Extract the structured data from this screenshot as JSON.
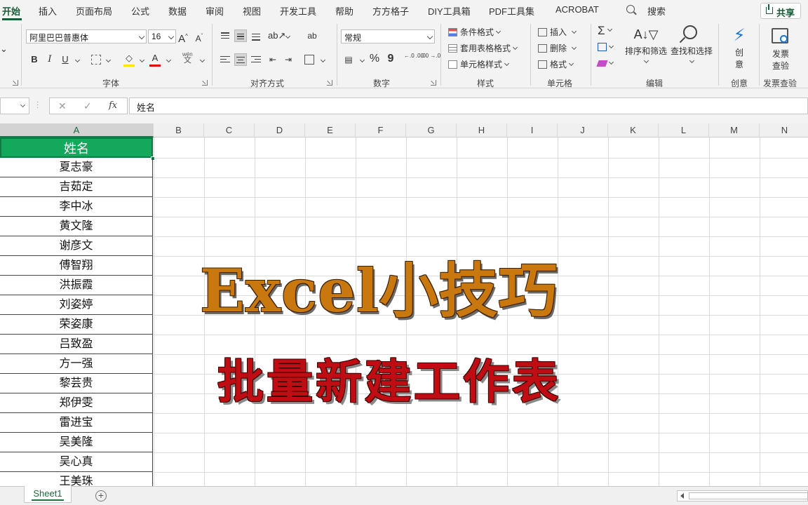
{
  "tabs": [
    "开始",
    "插入",
    "页面布局",
    "公式",
    "数据",
    "审阅",
    "视图",
    "开发工具",
    "帮助",
    "方方格子",
    "DIY工具箱",
    "PDF工具集",
    "ACROBAT"
  ],
  "search": {
    "label": "搜索"
  },
  "share": {
    "label": "共享"
  },
  "font": {
    "name": "阿里巴巴普惠体",
    "size": "16",
    "grow": "A",
    "shrink": "A",
    "bold": "B",
    "italic": "I",
    "underline": "U",
    "color_letter": "A",
    "phonetic_top": "wén",
    "phonetic_bottom": "文"
  },
  "align": {
    "wrap": "ab"
  },
  "number": {
    "format": "常规",
    "percent": "%",
    "comma": "9",
    "inc": "←.0 .00",
    "dec": ".00 →.0"
  },
  "styles": {
    "conditional": "条件格式",
    "table": "套用表格格式",
    "cell": "单元格样式"
  },
  "cells": {
    "insert": "插入",
    "delete": "删除",
    "format": "格式"
  },
  "editing": {
    "sigma": "Σ",
    "sort_filter": "排序和筛选",
    "find_select": "查找和选择"
  },
  "creative": {
    "label_line1": "创",
    "label_line2": "意"
  },
  "invoice": {
    "label_line1": "发票",
    "label_line2": "查验"
  },
  "group_labels": {
    "font": "字体",
    "alignment": "对齐方式",
    "number": "数字",
    "styles": "样式",
    "cells": "单元格",
    "editing": "编辑",
    "creative": "创意",
    "invoice": "发票查验"
  },
  "formula_bar": {
    "cancel": "✕",
    "enter": "✓",
    "fx": "fx",
    "content": "姓名"
  },
  "columns": [
    "A",
    "B",
    "C",
    "D",
    "E",
    "F",
    "G",
    "H",
    "I",
    "J",
    "K",
    "L",
    "M",
    "N"
  ],
  "header_cell": "姓名",
  "names": [
    "夏志豪",
    "吉茹定",
    "李中冰",
    "黄文隆",
    "谢彦文",
    "傅智翔",
    "洪振霞",
    "刘姿婷",
    "荣姿康",
    "吕致盈",
    "方一强",
    "黎芸贵",
    "郑伊雯",
    "雷进宝",
    "吴美隆",
    "吴心真",
    "王美珠"
  ],
  "overlay": {
    "title": "Excel小技巧",
    "subtitle": "批量新建工作表"
  },
  "sheet_tab": "Sheet1",
  "add_sheet": "+",
  "colors": {
    "accent": "#185c37",
    "header_fill": "#13a85b",
    "title": "#c8780f",
    "subtitle": "#c00d14"
  }
}
